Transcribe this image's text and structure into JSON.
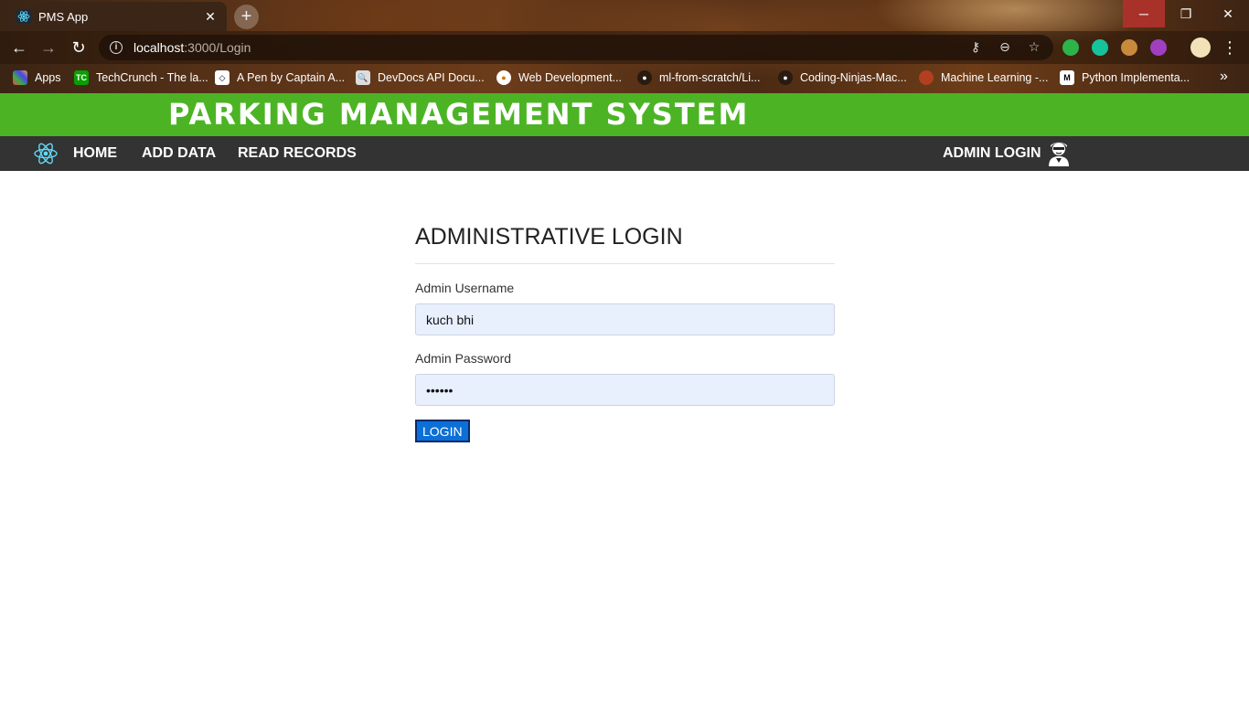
{
  "browser": {
    "tab_title": "PMS App",
    "url_host": "localhost",
    "url_path": ":3000/Login",
    "bookmarks": [
      "Apps",
      "TechCrunch - The la...",
      "A Pen by Captain A...",
      "DevDocs API Docu...",
      "Web Development...",
      "ml-from-scratch/Li...",
      "Coding-Ninjas-Mac...",
      "Machine Learning -...",
      "Python Implementa..."
    ]
  },
  "app": {
    "title": "PARKING MANAGEMENT SYSTEM",
    "nav": {
      "home": "HOME",
      "add_data": "ADD DATA",
      "read_records": "READ RECORDS",
      "admin_login": "ADMIN LOGIN"
    },
    "login": {
      "heading": "ADMINISTRATIVE LOGIN",
      "username_label": "Admin Username",
      "username_value": "kuch bhi",
      "password_label": "Admin Password",
      "password_value": "••••••",
      "button": "LOGIN"
    }
  },
  "colors": {
    "header_green": "#4cb424",
    "navbar_dark": "#333333",
    "button_blue": "#0b6fd6"
  }
}
